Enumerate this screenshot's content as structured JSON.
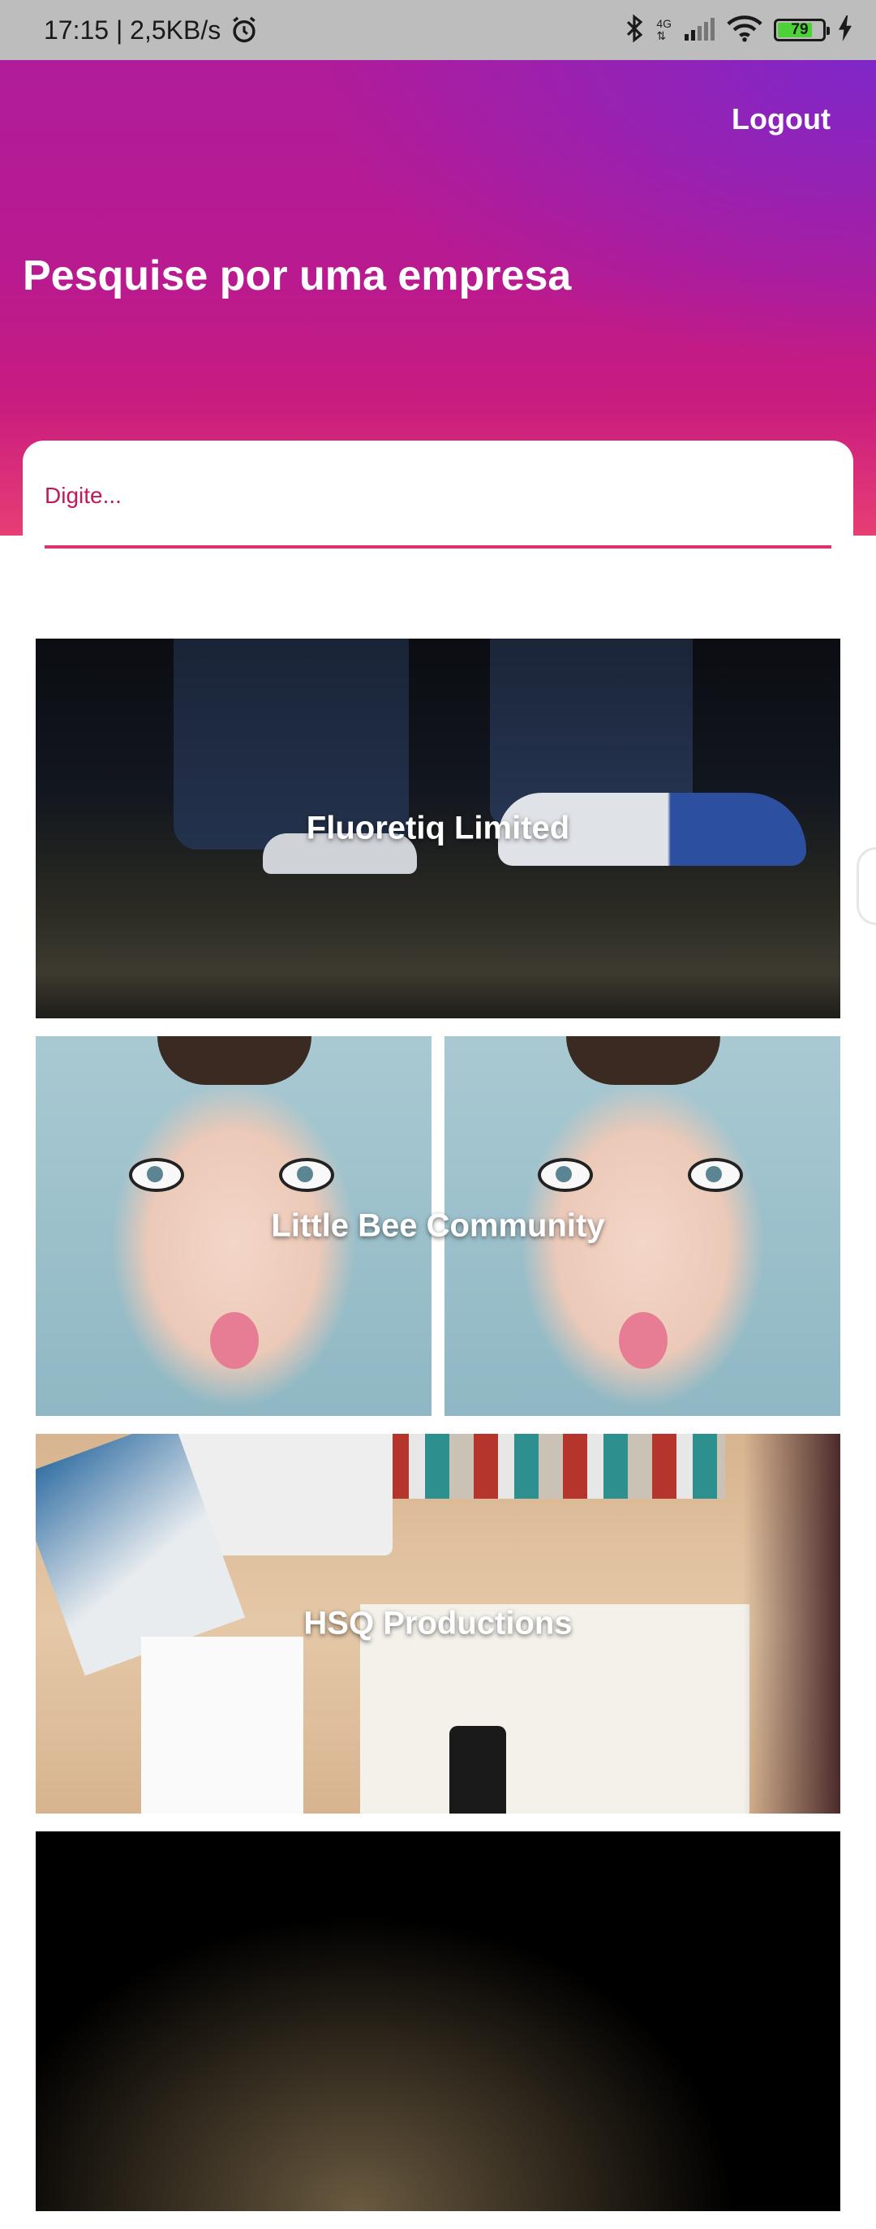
{
  "status_bar": {
    "time_speed": "17:15 | 2,5KB/s",
    "network": "4G",
    "battery": "79",
    "battery_level": 0.79,
    "icons": [
      "alarm-icon",
      "bluetooth-icon",
      "signal-icon",
      "wifi-icon",
      "battery-icon",
      "charging-icon"
    ]
  },
  "header": {
    "logout_label": "Logout",
    "title": "Pesquise por uma empresa"
  },
  "search": {
    "placeholder": "Digite..."
  },
  "companies": [
    {
      "name": "Fluoretiq Limited"
    },
    {
      "name": "Little Bee Community"
    },
    {
      "name": "HSQ Productions"
    }
  ],
  "colors": {
    "header_top": "#b01c9a",
    "header_bottom": "#e83e74",
    "accent": "#e0306e",
    "status_bar": "#bdbdbd"
  }
}
